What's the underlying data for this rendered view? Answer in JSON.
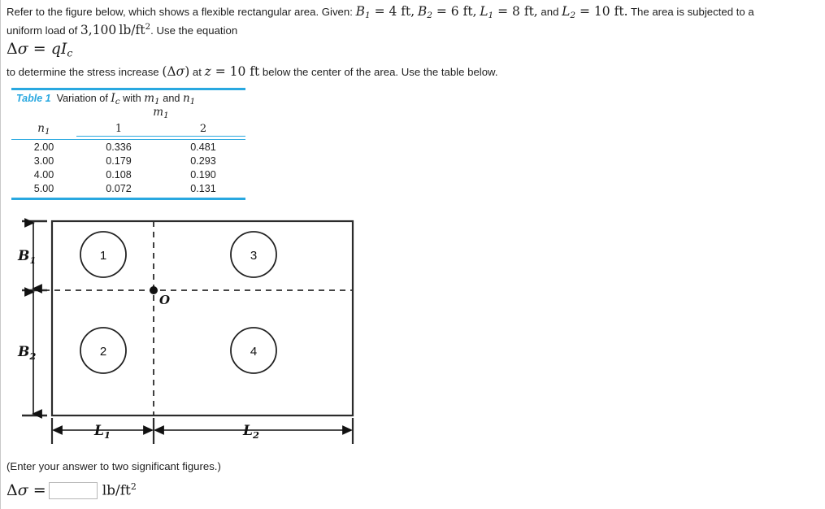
{
  "problem": {
    "intro_prefix": "Refer to the figure below, which shows a flexible rectangular area. Given:",
    "givens": [
      {
        "symbol": "B",
        "sub": "1",
        "value": "4",
        "unit": "ft",
        "sep": ","
      },
      {
        "symbol": "B",
        "sub": "2",
        "value": "6",
        "unit": "ft",
        "sep": ","
      },
      {
        "symbol": "L",
        "sub": "1",
        "value": "8",
        "unit": "ft",
        "sep": ", and"
      },
      {
        "symbol": "L",
        "sub": "2",
        "value": "10",
        "unit": "ft",
        "sep": "."
      }
    ],
    "intro_suffix": "The area is subjected to a",
    "line2_prefix": "uniform load of",
    "load_value": "3,100",
    "load_unit": "lb/ft",
    "load_unit_exp": "2",
    "line2_suffix": ". Use the equation",
    "equation": "Δσ = qI",
    "equation_sub": "c",
    "line3_a": "to determine the stress increase",
    "line3_paren": "(Δσ)",
    "line3_b": "at",
    "z_symbol": "z",
    "z_value": "10",
    "z_unit": "ft",
    "line3_c": "below the center of the area. Use the table below."
  },
  "table": {
    "label": "Table 1",
    "caption_text": "Variation of",
    "caption_symbol": "I",
    "caption_symbol_sub": "c",
    "caption_text2": "with",
    "caption_var1": "m",
    "caption_var1_sub": "1",
    "caption_and": "and",
    "caption_var2": "n",
    "caption_var2_sub": "1",
    "column_group_header": "m",
    "column_group_header_sub": "1",
    "row_header": "n",
    "row_header_sub": "1",
    "column_headers": [
      "1",
      "2"
    ],
    "rows": [
      {
        "n1": "2.00",
        "values": [
          "0.336",
          "0.481"
        ]
      },
      {
        "n1": "3.00",
        "values": [
          "0.179",
          "0.293"
        ]
      },
      {
        "n1": "4.00",
        "values": [
          "0.108",
          "0.190"
        ]
      },
      {
        "n1": "5.00",
        "values": [
          "0.072",
          "0.131"
        ]
      }
    ],
    "rule_color": "#29a8e0"
  },
  "figure": {
    "origin_label": "O",
    "quadrant_labels": [
      "1",
      "2",
      "3",
      "4"
    ],
    "vertical_dims": [
      {
        "symbol": "B",
        "sub": "1"
      },
      {
        "symbol": "B",
        "sub": "2"
      }
    ],
    "horizontal_dims": [
      {
        "symbol": "L",
        "sub": "1"
      },
      {
        "symbol": "L",
        "sub": "2"
      }
    ]
  },
  "answer": {
    "note": "(Enter your answer to two significant figures.)",
    "lhs_symbol": "Δσ =",
    "input_value": "",
    "input_placeholder": "",
    "units": "lb/ft",
    "units_exp": "2"
  }
}
